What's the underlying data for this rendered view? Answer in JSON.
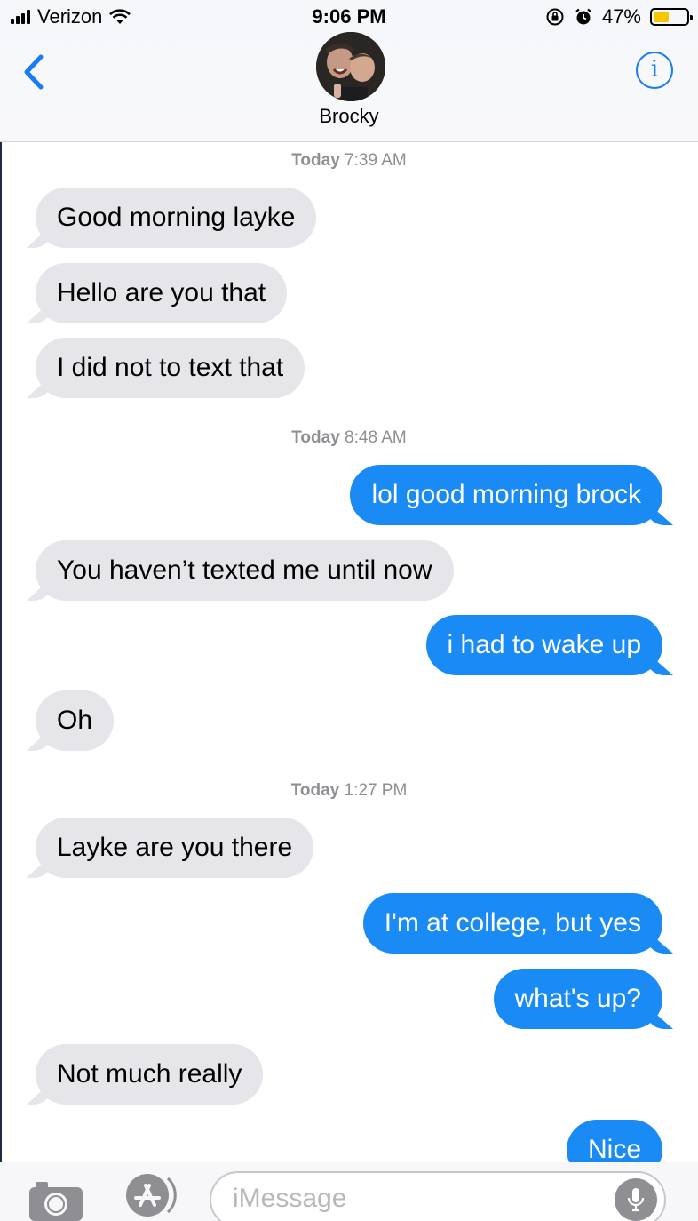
{
  "status_bar": {
    "carrier": "Verizon",
    "time": "9:06 PM",
    "battery_percent": "47%",
    "battery_level": 0.47,
    "battery_color": "#f7c600"
  },
  "header": {
    "back_icon": "chevron-left-icon",
    "contact_name": "Brocky",
    "info_icon": "info-icon",
    "info_glyph": "i"
  },
  "conversation": {
    "timestamps": [
      {
        "day": "Today",
        "time": "7:39 AM"
      },
      {
        "day": "Today",
        "time": "8:48 AM"
      },
      {
        "day": "Today",
        "time": "1:27 PM"
      }
    ],
    "messages": [
      {
        "direction": "incoming",
        "text": "Good morning layke"
      },
      {
        "direction": "incoming",
        "text": "Hello are you that"
      },
      {
        "direction": "incoming",
        "text": "I did not to text that"
      },
      {
        "direction": "outgoing",
        "text": "lol good morning brock"
      },
      {
        "direction": "incoming",
        "text": "You haven’t texted me until now"
      },
      {
        "direction": "outgoing",
        "text": "i had to wake up"
      },
      {
        "direction": "incoming",
        "text": "Oh"
      },
      {
        "direction": "incoming",
        "text": "Layke are you there"
      },
      {
        "direction": "outgoing",
        "text": "I'm at college, but yes"
      },
      {
        "direction": "outgoing",
        "text": "what's up?"
      },
      {
        "direction": "incoming",
        "text": "Not much really"
      },
      {
        "direction": "outgoing",
        "text": "Nice"
      }
    ]
  },
  "input_bar": {
    "placeholder": "iMessage",
    "camera_icon": "camera-icon",
    "appstore_icon": "app-store-icon",
    "mic_icon": "microphone-icon"
  },
  "colors": {
    "outgoing_bubble": "#1a8af5",
    "incoming_bubble": "#e5e5ea",
    "accent": "#1a7cf4"
  }
}
